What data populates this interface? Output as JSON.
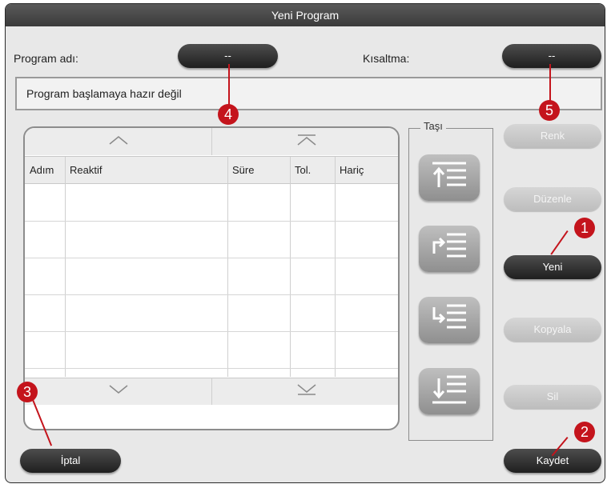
{
  "dialog": {
    "title": "Yeni Program"
  },
  "header": {
    "program_name_label": "Program adı:",
    "program_name_value": "--",
    "short_label": "Kısaltma:",
    "short_value": "--"
  },
  "status_text": "Program başlamaya hazır değil",
  "table": {
    "columns": [
      "Adım",
      "Reaktif",
      "Süre",
      "Tol.",
      "Hariç"
    ],
    "rows": []
  },
  "move": {
    "label": "Taşı"
  },
  "side_buttons": {
    "renk": "Renk",
    "duzenle": "Düzenle",
    "yeni": "Yeni",
    "kopyala": "Kopyala",
    "sil": "Sil"
  },
  "footer": {
    "cancel": "İptal",
    "save": "Kaydet"
  },
  "callouts": [
    "1",
    "2",
    "3",
    "4",
    "5"
  ],
  "colors": {
    "accent": "#c4141c",
    "title_bar": "#3a3a3a",
    "button_dark": "#1f1f1f"
  }
}
